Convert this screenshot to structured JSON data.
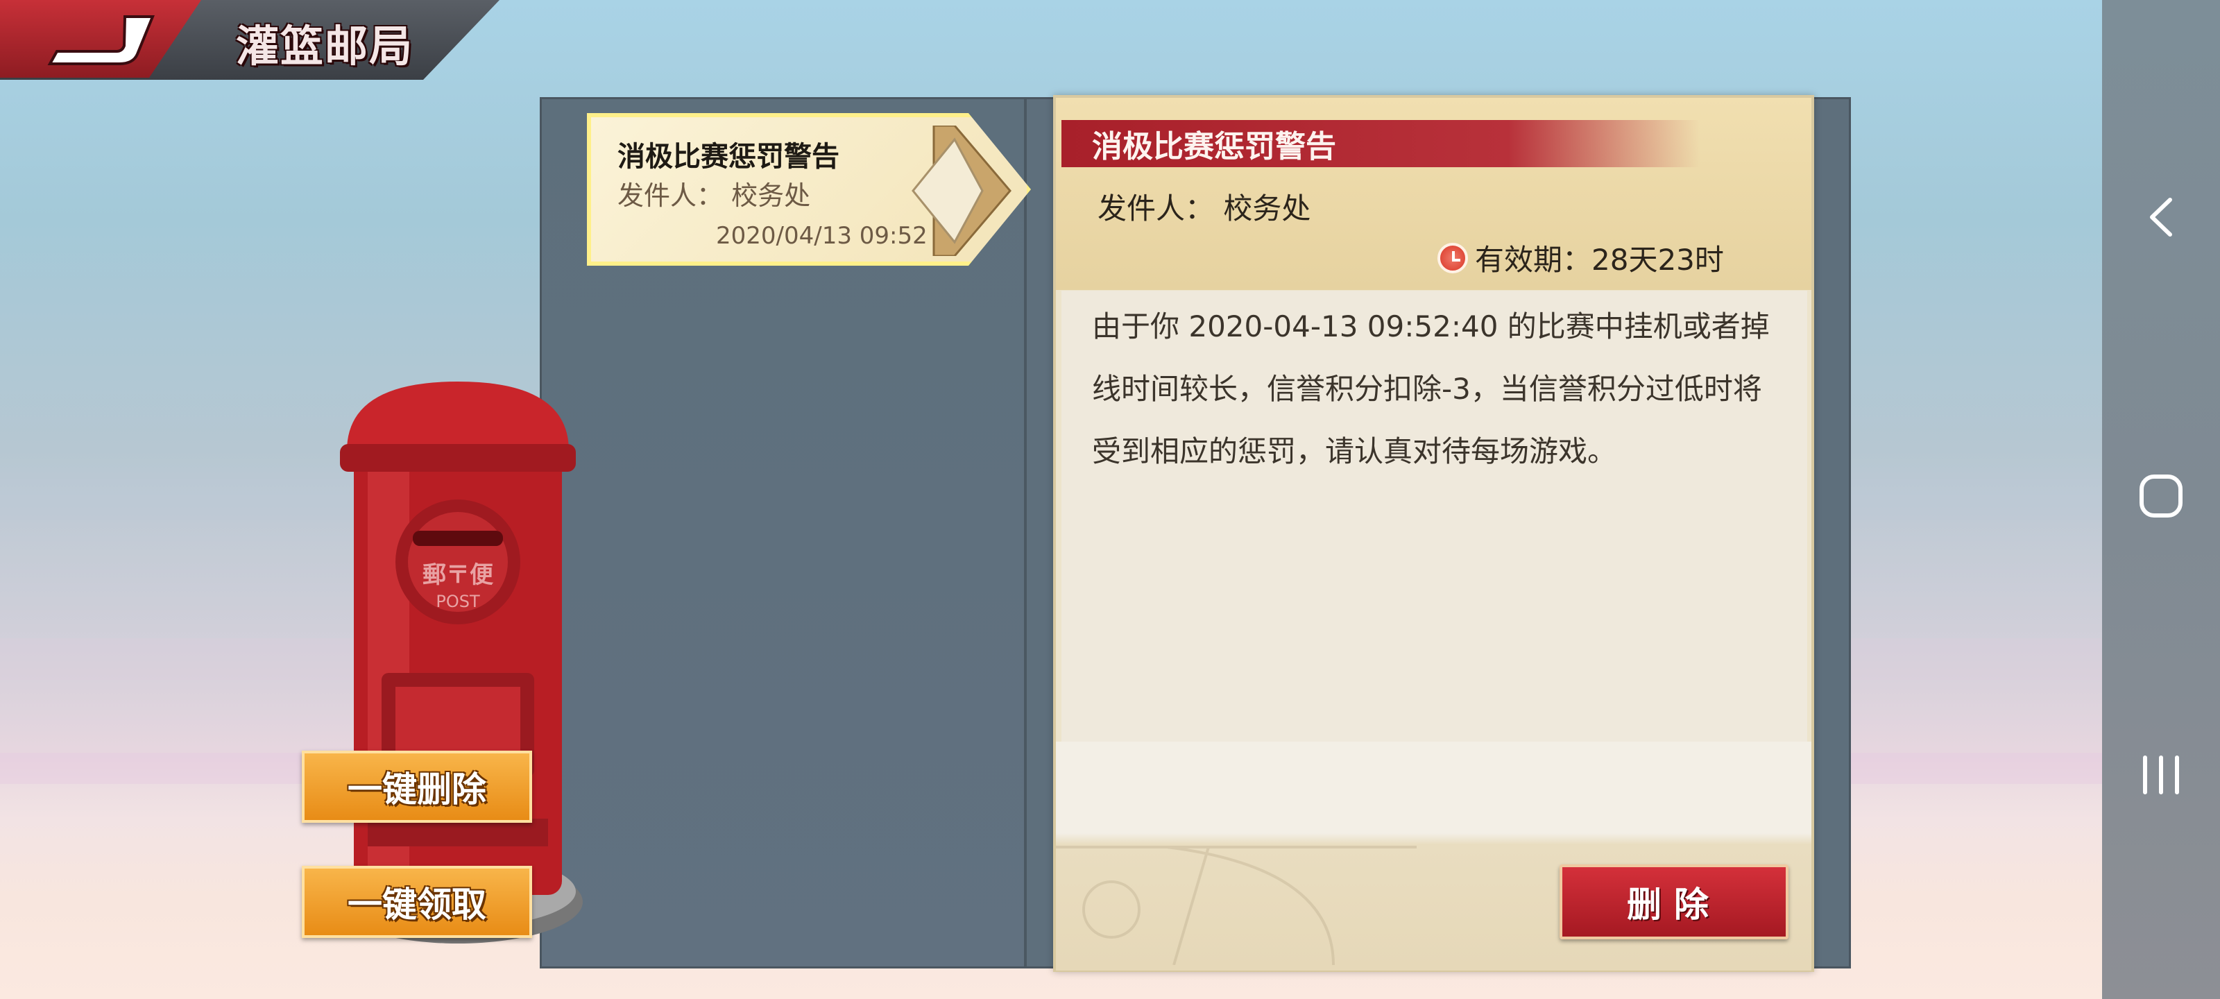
{
  "header": {
    "title": "灌篮邮局",
    "back_label": ""
  },
  "mail_list": [
    {
      "title": "消极比赛惩罚警告",
      "sender": "发件人： 校务处",
      "date": "2020/04/13 09:52"
    }
  ],
  "detail": {
    "title": "消极比赛惩罚警告",
    "sender": "发件人： 校务处",
    "expiry": "有效期：28天23时",
    "body": "由于你 2020-04-13 09:52:40 的比赛中挂机或者掉线时间较长，信誉积分扣除-3，当信誉积分过低时将受到相应的惩罚，请认真对待每场游戏。",
    "delete_label": "删除"
  },
  "postbox": {
    "label_top": "郵〒便",
    "label_bottom": "POST"
  },
  "actions": {
    "delete_all": "一键删除",
    "claim_all": "一键领取"
  },
  "colors": {
    "accent_red": "#a8202a",
    "button_orange": "#e88c16",
    "panel_bg": "#5e6f7c"
  },
  "icons": {
    "back": "back-arrow-icon",
    "envelope": "envelope-icon",
    "clock": "clock-icon",
    "nav_back": "chevron-left-icon",
    "nav_home": "home-icon",
    "nav_recent": "recent-apps-icon"
  }
}
